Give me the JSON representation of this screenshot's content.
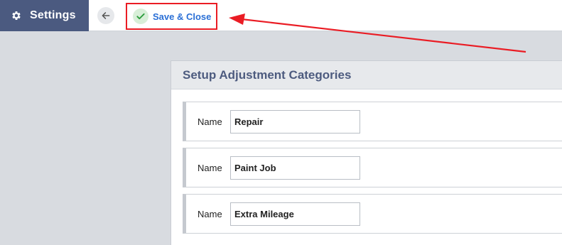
{
  "header": {
    "app_title": "Settings",
    "gear_icon": "gear-icon",
    "back_icon": "arrow-left-icon",
    "save_label": "Save & Close",
    "check_icon": "check-icon"
  },
  "annotation": {
    "highlight_color": "#ea1c24"
  },
  "panel": {
    "title": "Setup Adjustment Categories",
    "rows": [
      {
        "label": "Name",
        "value": "Repair"
      },
      {
        "label": "Name",
        "value": "Paint Job"
      },
      {
        "label": "Name",
        "value": "Extra Mileage"
      }
    ]
  },
  "colors": {
    "brand": "#4b5a80",
    "link": "#2a6fd6",
    "title": "#4d5b7f",
    "success": "#2e9e3e"
  }
}
